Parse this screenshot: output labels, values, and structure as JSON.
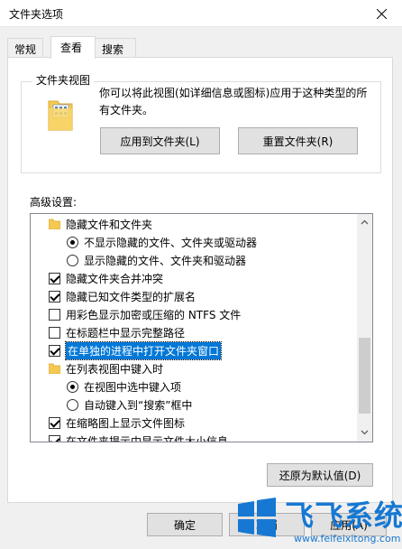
{
  "window": {
    "title": "文件夹选项"
  },
  "tabs": [
    {
      "label": "常规"
    },
    {
      "label": "查看",
      "active": true
    },
    {
      "label": "搜索"
    }
  ],
  "folder_views": {
    "legend": "文件夹视图",
    "description": "你可以将此视图(如详细信息或图标)应用于这种类型的所有文件夹。",
    "apply_button": "应用到文件夹(L)",
    "reset_button": "重置文件夹(R)"
  },
  "advanced": {
    "label": "高级设置:",
    "items": [
      {
        "kind": "folder",
        "label": "隐藏文件和文件夹"
      },
      {
        "kind": "radio",
        "checked": true,
        "label": "不显示隐藏的文件、文件夹或驱动器"
      },
      {
        "kind": "radio",
        "checked": false,
        "label": "显示隐藏的文件、文件夹和驱动器"
      },
      {
        "kind": "checkbox",
        "checked": true,
        "label": "隐藏文件夹合并冲突"
      },
      {
        "kind": "checkbox",
        "checked": true,
        "label": "隐藏已知文件类型的扩展名"
      },
      {
        "kind": "checkbox",
        "checked": false,
        "label": "用彩色显示加密或压缩的 NTFS 文件"
      },
      {
        "kind": "checkbox",
        "checked": false,
        "label": "在标题栏中显示完整路径"
      },
      {
        "kind": "checkbox",
        "checked": true,
        "label": "在单独的进程中打开文件夹窗口",
        "selected": true
      },
      {
        "kind": "folder",
        "label": "在列表视图中键入时"
      },
      {
        "kind": "radio",
        "checked": true,
        "label": "在视图中选中键入项"
      },
      {
        "kind": "radio",
        "checked": false,
        "label": "自动键入到“搜索”框中"
      },
      {
        "kind": "checkbox",
        "checked": true,
        "label": "在缩略图上显示文件图标"
      },
      {
        "kind": "checkbox",
        "checked": true,
        "label": "在文件夹提示中显示文件大小信息"
      }
    ]
  },
  "buttons": {
    "restore": "还原为默认值(D)",
    "ok": "确定",
    "cancel": "取消",
    "apply": "应用(A)"
  },
  "watermark": {
    "text": "飞飞系统",
    "url": "www.feifeixitong.com"
  },
  "colors": {
    "selection": "#0078d7",
    "folder": "#f5c951",
    "watermark": "#1678d2"
  }
}
